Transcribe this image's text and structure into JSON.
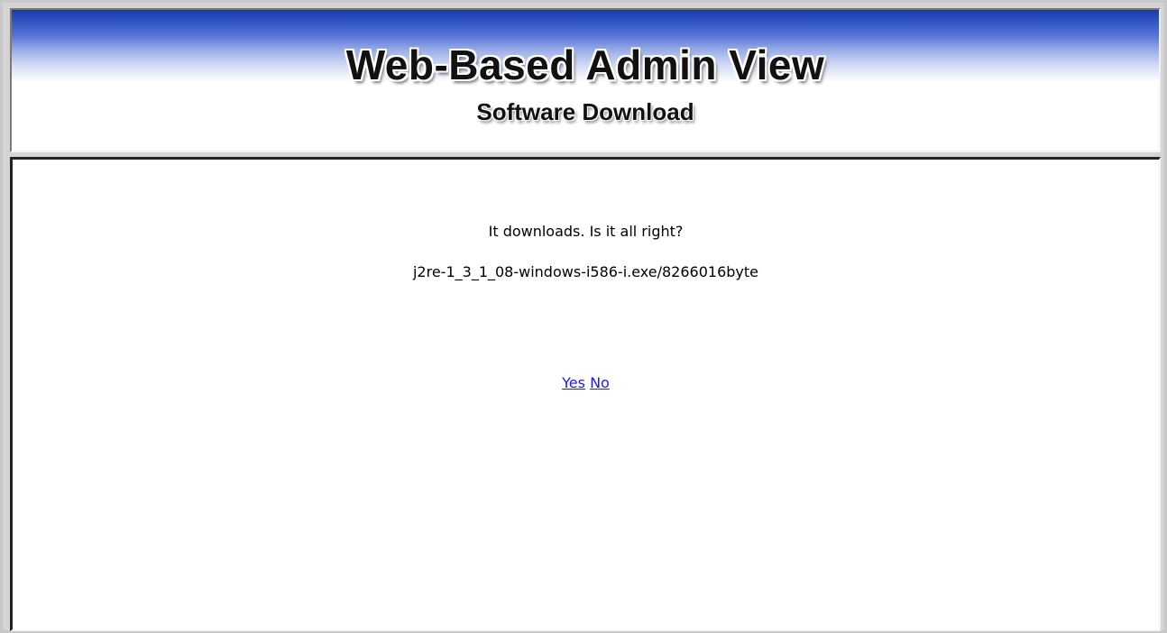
{
  "header": {
    "title": "Web-Based Admin View",
    "subtitle": "Software Download"
  },
  "dialog": {
    "question": "It downloads. Is it all right?",
    "file_info": "j2re-1_3_1_08-windows-i586-i.exe/8266016byte",
    "yes_label": "Yes",
    "no_label": "No"
  },
  "colors": {
    "banner_blue": "#1c3aa6",
    "link": "#1a1aee"
  }
}
